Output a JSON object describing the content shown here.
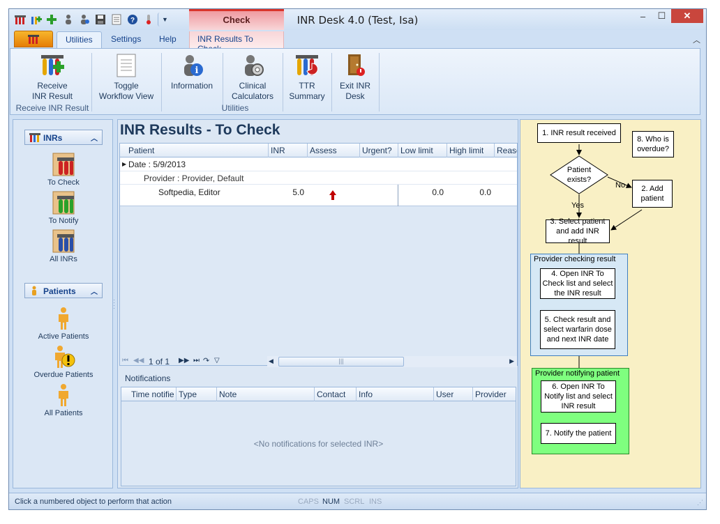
{
  "window": {
    "title": "INR Desk 4.0 (Test, Isa)",
    "context_tab_group": "Check"
  },
  "quick_access": [
    "receive-icon",
    "add-icon",
    "plus-icon",
    "patient-icon",
    "patient-search-icon",
    "save-icon",
    "list-icon",
    "help-icon",
    "thermometer-icon",
    "customize-icon"
  ],
  "tabs": [
    "Utilities",
    "Settings",
    "Help",
    "INR Results To Check"
  ],
  "ribbon": {
    "receive_label": "Receive\nINR Result",
    "receive_group": "Receive INR Result",
    "toggle_label": "Toggle\nWorkflow View",
    "information_label": "Information",
    "calculators_label": "Clinical\nCalculators",
    "ttr_label": "TTR\nSummary",
    "exit_label": "Exit INR\nDesk",
    "utilities_group": "Utilities"
  },
  "nav": {
    "inrs_header": "INRs",
    "to_check": "To Check",
    "to_notify": "To Notify",
    "all_inrs": "All INRs",
    "patients_header": "Patients",
    "active_patients": "Active Patients",
    "overdue_patients": "Overdue Patients",
    "all_patients": "All Patients"
  },
  "main": {
    "title": "INR Results - To Check",
    "columns": [
      "Patient",
      "INR",
      "Assess",
      "Urgent?",
      "Low limit",
      "High limit",
      "Reaso"
    ],
    "group_date": "Date : 5/9/2013",
    "group_provider": "Provider : Provider, Default",
    "rows": [
      {
        "patient": "Softpedia, Editor",
        "inr": "5.0",
        "assess": "up-arrow",
        "urgent": "",
        "low": "0.0",
        "high": "0.0"
      }
    ],
    "pager": "1 of 1"
  },
  "notifications": {
    "title": "Notifications",
    "columns": [
      "Time notifie",
      "Type",
      "Note",
      "Contact",
      "Info",
      "User",
      "Provider"
    ],
    "empty": "<No notifications for selected INR>"
  },
  "workflow": {
    "step1": "1.  INR result received",
    "step8": "8. Who is overdue?",
    "decision": "Patient exists?",
    "no": "No",
    "yes": "Yes",
    "step2": "2. Add patient",
    "step3": "3. Select patient and add INR result",
    "group_provider_checking": "Provider checking result",
    "step4": "4. Open INR To Check list and select the INR result",
    "step5": "5. Check result and select warfarin dose and next INR date",
    "group_provider_notifying": "Provider notifying patient",
    "step6": "6. Open INR To Notify list and select INR result",
    "step7": "7. Notify the patient"
  },
  "status": {
    "message": "Click a numbered object to perform that action",
    "indicators": [
      "CAPS",
      "NUM",
      "SCRL",
      "INS"
    ],
    "active_indicator": "NUM"
  },
  "colors": {
    "checking_group": "#d6e8f5",
    "notifying_group": "#7fff7f",
    "workflow_bg": "#f9f0c5",
    "context_tab": "#d9342b"
  }
}
